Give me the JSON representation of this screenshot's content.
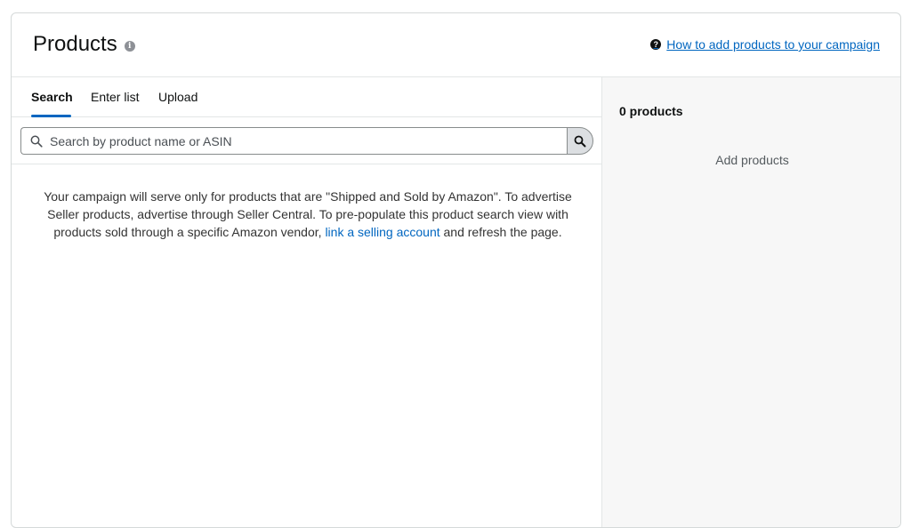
{
  "header": {
    "title": "Products",
    "info_icon": "info-icon",
    "help_icon": "question-circle-icon",
    "help_link": "How to add products to your campaign"
  },
  "tabs": [
    {
      "label": "Search",
      "active": true
    },
    {
      "label": "Enter list",
      "active": false
    },
    {
      "label": "Upload",
      "active": false
    }
  ],
  "search": {
    "placeholder": "Search by product name or ASIN",
    "value": "",
    "icon": "search-icon"
  },
  "notice": {
    "text_before": "Your campaign will serve only for products that are \"Shipped and Sold by Amazon\". To advertise Seller products, advertise through Seller Central. To pre-populate this product search view with products sold through a specific Amazon vendor, ",
    "link": "link a selling account",
    "text_after": " and refresh the page."
  },
  "selection": {
    "count_label": "0 products",
    "empty_label": "Add products"
  },
  "colors": {
    "accent": "#0066c0",
    "border": "#d5d9d9",
    "right_panel_bg": "#f7f7f7"
  }
}
